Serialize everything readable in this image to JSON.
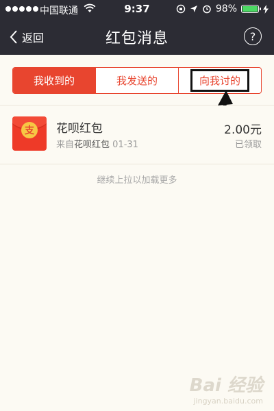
{
  "status_bar": {
    "carrier": "中国联通",
    "time": "9:37",
    "battery_percent": "98%",
    "battery_level": 0.98
  },
  "nav": {
    "back_label": "返回",
    "title": "红包消息",
    "help_label": "?"
  },
  "tabs": [
    {
      "label": "我收到的",
      "active": true
    },
    {
      "label": "我发送的",
      "active": false
    },
    {
      "label": "向我讨的",
      "active": false
    }
  ],
  "list": [
    {
      "title": "花呗红包",
      "source_prefix": "来自",
      "source": "花呗红包",
      "date": "01-31",
      "amount": "2.00元",
      "status": "已领取",
      "icon_glyph": "支"
    }
  ],
  "load_more": "继续上拉以加载更多",
  "watermark": {
    "main": "Bai 经验",
    "url": "jingyan.baidu.com"
  },
  "colors": {
    "accent": "#e8452f",
    "header": "#2c2c34",
    "background": "#fcfaf3"
  }
}
